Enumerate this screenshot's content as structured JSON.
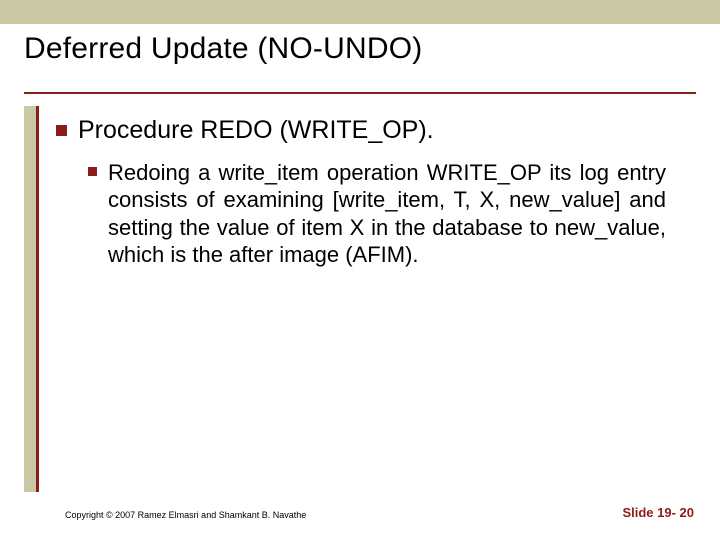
{
  "title": "Deferred Update (NO-UNDO)",
  "bullets": {
    "level1": "Procedure REDO (WRITE_OP).",
    "level2": "Redoing a write_item operation WRITE_OP its log entry consists of examining [write_item, T, X, new_value] and setting the value of item X in the database to new_value, which is the after image (AFIM)."
  },
  "footer": {
    "copyright": "Copyright © 2007 Ramez Elmasri and Shamkant B. Navathe",
    "slide": "Slide 19- 20"
  },
  "colors": {
    "accent": "#8a1c1c",
    "band": "#c9c9a6"
  }
}
